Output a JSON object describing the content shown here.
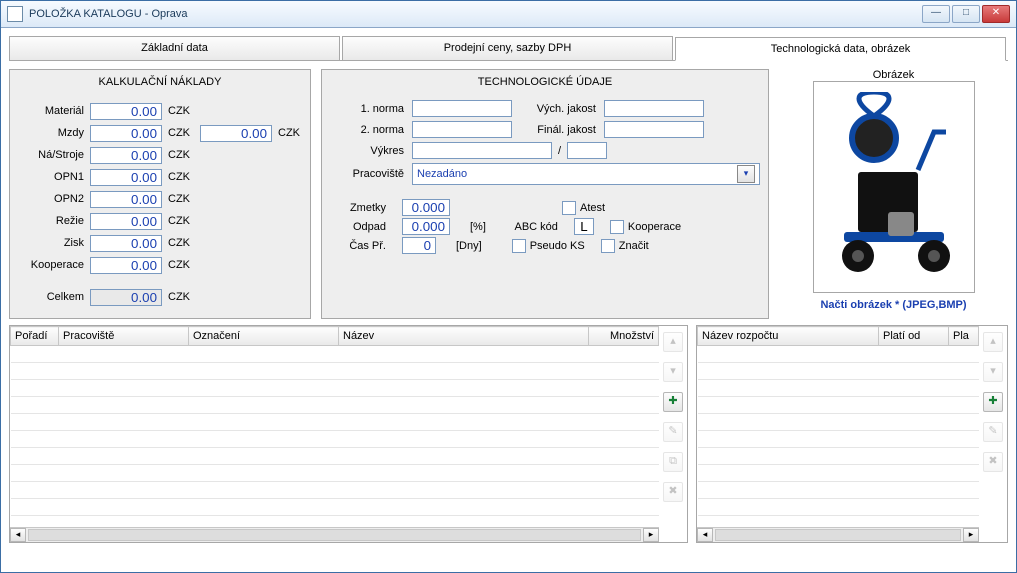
{
  "window": {
    "title": "POLOŽKA KATALOGU - Oprava"
  },
  "tabs": {
    "t1": "Základní data",
    "t2": "Prodejní ceny, sazby DPH",
    "t3": "Technologická data, obrázek"
  },
  "kalk": {
    "header": "KALKULAČNÍ  NÁKLADY",
    "rows": {
      "material": {
        "lbl": "Materiál",
        "val": "0.00",
        "cur": "CZK"
      },
      "mzdy": {
        "lbl": "Mzdy",
        "val": "0.00",
        "cur": "CZK",
        "val2": "0.00",
        "cur2": "CZK"
      },
      "nastroje": {
        "lbl": "Ná/Stroje",
        "val": "0.00",
        "cur": "CZK"
      },
      "opn1": {
        "lbl": "OPN1",
        "val": "0.00",
        "cur": "CZK"
      },
      "opn2": {
        "lbl": "OPN2",
        "val": "0.00",
        "cur": "CZK"
      },
      "rezie": {
        "lbl": "Režie",
        "val": "0.00",
        "cur": "CZK"
      },
      "zisk": {
        "lbl": "Zisk",
        "val": "0.00",
        "cur": "CZK"
      },
      "kooperace": {
        "lbl": "Kooperace",
        "val": "0.00",
        "cur": "CZK"
      },
      "celkem": {
        "lbl": "Celkem",
        "val": "0.00",
        "cur": "CZK"
      }
    }
  },
  "tech": {
    "header": "TECHNOLOGICKÉ  ÚDAJE",
    "norma1": {
      "lbl": "1. norma",
      "val": ""
    },
    "vychjak": {
      "lbl": "Vých. jakost",
      "val": ""
    },
    "norma2": {
      "lbl": "2. norma",
      "val": ""
    },
    "finjak": {
      "lbl": "Finál. jakost",
      "val": ""
    },
    "vykres": {
      "lbl": "Výkres",
      "val1": "",
      "sep": "/",
      "val2": ""
    },
    "pracoviste": {
      "lbl": "Pracoviště",
      "val": "Nezadáno"
    },
    "zmetky": {
      "lbl": "Zmetky",
      "val": "0.000"
    },
    "odpad": {
      "lbl": "Odpad",
      "val": "0.000",
      "unit": "[%]"
    },
    "abc": {
      "lbl": "ABC kód",
      "val": "L"
    },
    "caspr": {
      "lbl": "Čas Př.",
      "val": "0",
      "unit": "[Dny]"
    },
    "chk": {
      "atest": "Atest",
      "kooperace": "Kooperace",
      "pseudoks": "Pseudo KS",
      "znacit": "Značit"
    }
  },
  "image": {
    "header": "Obrázek",
    "load": "Načti obrázek  *  (JPEG,BMP)"
  },
  "gridL": {
    "cols": {
      "poradi": "Pořadí",
      "prac": "Pracoviště",
      "ozn": "Označení",
      "nazev": "Název",
      "mnoz": "Množství"
    }
  },
  "gridR": {
    "cols": {
      "nazev": "Název rozpočtu",
      "plod": "Platí od",
      "pla": "Pla"
    }
  }
}
